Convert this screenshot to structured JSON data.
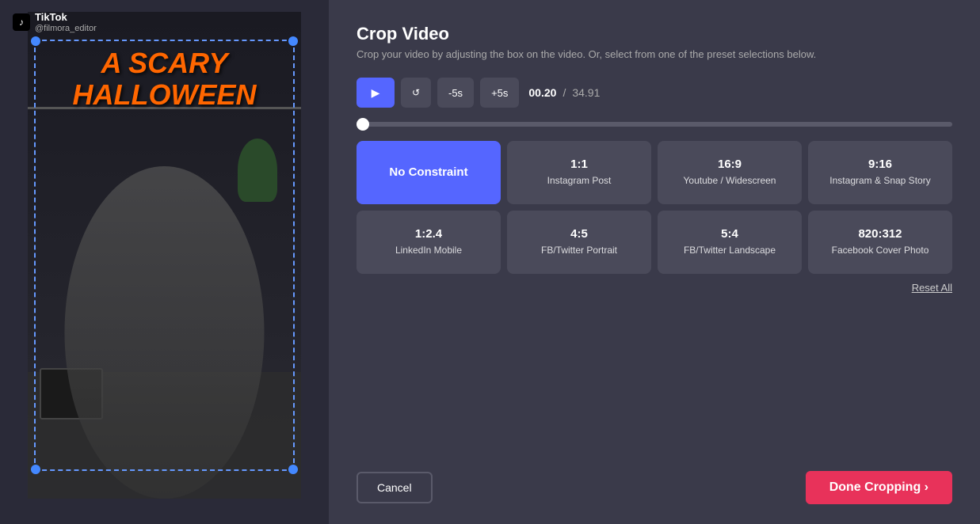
{
  "app": {
    "tiktok_logo": "♪",
    "tiktok_title": "TikTok",
    "tiktok_handle": "@filmora_editor"
  },
  "header": {
    "title": "Crop Video",
    "subtitle": "Crop your video by adjusting the box on the video. Or, select from one of the preset selections below."
  },
  "controls": {
    "play_icon": "▶",
    "reset_icon": "↺",
    "skip_back_label": "-5s",
    "skip_forward_label": "+5s",
    "current_time": "00.20",
    "separator": "/",
    "total_time": "34.91"
  },
  "presets": [
    {
      "ratio": "No Constraint",
      "label": "",
      "active": true
    },
    {
      "ratio": "1:1",
      "label": "Instagram Post",
      "active": false
    },
    {
      "ratio": "16:9",
      "label": "Youtube / Widescreen",
      "active": false
    },
    {
      "ratio": "9:16",
      "label": "Instagram & Snap Story",
      "active": false
    },
    {
      "ratio": "1:2.4",
      "label": "LinkedIn Mobile",
      "active": false
    },
    {
      "ratio": "4:5",
      "label": "FB/Twitter Portrait",
      "active": false
    },
    {
      "ratio": "5:4",
      "label": "FB/Twitter Landscape",
      "active": false
    },
    {
      "ratio": "820:312",
      "label": "Facebook Cover Photo",
      "active": false
    }
  ],
  "actions": {
    "reset_all": "Reset All",
    "cancel": "Cancel",
    "done": "Done Cropping ›"
  }
}
